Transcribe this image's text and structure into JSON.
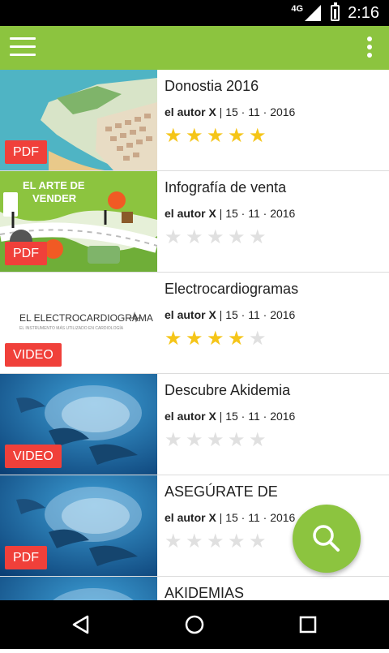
{
  "status_bar": {
    "network": "4G",
    "time": "2:16"
  },
  "app_bar": {
    "menu_icon": "hamburger-icon",
    "overflow_icon": "more-vert-icon"
  },
  "items": [
    {
      "title": "Donostia 2016",
      "author": "el autor X",
      "date": " | 15 · 11 · 2016",
      "type": "PDF",
      "rating": 5
    },
    {
      "title": "Infografía de venta",
      "author": "el autor X",
      "date": " | 15 · 11 · 2016",
      "type": "PDF",
      "rating": 0
    },
    {
      "title": "Electrocardiogramas",
      "author": "el autor X",
      "date": " | 15 · 11 · 2016",
      "type": "VIDEO",
      "rating": 4
    },
    {
      "title": "Descubre Akidemia",
      "author": "el autor X",
      "date": " | 15 · 11 · 2016",
      "type": "VIDEO",
      "rating": 0
    },
    {
      "title": "ASEGÚRATE DE",
      "author": "el autor X",
      "date": " | 15 · 11 · 2016",
      "type": "PDF",
      "rating": 0
    },
    {
      "title": "AKIDEMIAS",
      "author": "",
      "date": "",
      "type": "",
      "rating": 0
    }
  ],
  "thumbnails": {
    "infografia": {
      "line1": "EL ARTE DE",
      "line2": "VENDER"
    },
    "electro": {
      "title": "EL ELECTROCARDIOGRAMA",
      "subtitle": "EL INSTRUMENTO MÁS UTILIZADO EN CARDIOLOGÍA"
    }
  },
  "fab": {
    "icon": "search-icon"
  },
  "nav": {
    "back_icon": "back-triangle-icon",
    "home_icon": "home-circle-icon",
    "recents_icon": "recents-square-icon"
  },
  "colors": {
    "accent": "#8cc43f",
    "badge": "#f0403a",
    "star_on": "#f5c518",
    "star_off": "#e0e0e0"
  }
}
